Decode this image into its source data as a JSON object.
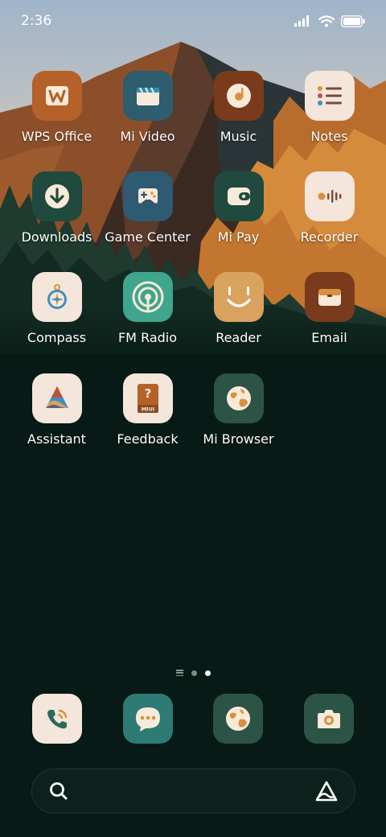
{
  "status_bar": {
    "time": "2:36",
    "battery_level": 1.0
  },
  "apps": [
    {
      "label": "WPS Office",
      "icon": "wps-office-icon",
      "bg": "#b5612a"
    },
    {
      "label": "Mi Video",
      "icon": "mi-video-icon",
      "bg": "#2e5d6e"
    },
    {
      "label": "Music",
      "icon": "music-icon",
      "bg": "#7a3a1c"
    },
    {
      "label": "Notes",
      "icon": "notes-icon",
      "bg": "#f4e6da"
    },
    {
      "label": "Downloads",
      "icon": "downloads-icon",
      "bg": "#1f4a3d"
    },
    {
      "label": "Game Center",
      "icon": "game-center-icon",
      "bg": "#2e5a72"
    },
    {
      "label": "Mi Pay",
      "icon": "mi-pay-icon",
      "bg": "#1f4a3d"
    },
    {
      "label": "Recorder",
      "icon": "recorder-icon",
      "bg": "#f4e6da"
    },
    {
      "label": "Compass",
      "icon": "compass-icon",
      "bg": "#f4e6da"
    },
    {
      "label": "FM Radio",
      "icon": "fm-radio-icon",
      "bg": "#3fa58c"
    },
    {
      "label": "Reader",
      "icon": "reader-icon",
      "bg": "#d9a25f"
    },
    {
      "label": "Email",
      "icon": "email-icon",
      "bg": "#7a3a1c"
    },
    {
      "label": "Assistant",
      "icon": "assistant-icon",
      "bg": "#f4e6da"
    },
    {
      "label": "Feedback",
      "icon": "feedback-icon",
      "bg": "#f4e6da",
      "badge": "MIUI"
    },
    {
      "label": "Mi Browser",
      "icon": "mi-browser-icon",
      "bg": "#2b5447"
    }
  ],
  "page_indicator": {
    "pages": 3,
    "active_index": 2,
    "first_is_menu": true
  },
  "dock": [
    {
      "icon": "phone-icon",
      "bg": "#f4e6da"
    },
    {
      "icon": "messages-icon",
      "bg": "#2e7a74"
    },
    {
      "icon": "browser-icon",
      "bg": "#2b5447"
    },
    {
      "icon": "camera-icon",
      "bg": "#2b5447"
    }
  ],
  "search_bar": {
    "left_icon": "search-icon",
    "right_icon": "assistant-logo-icon"
  }
}
